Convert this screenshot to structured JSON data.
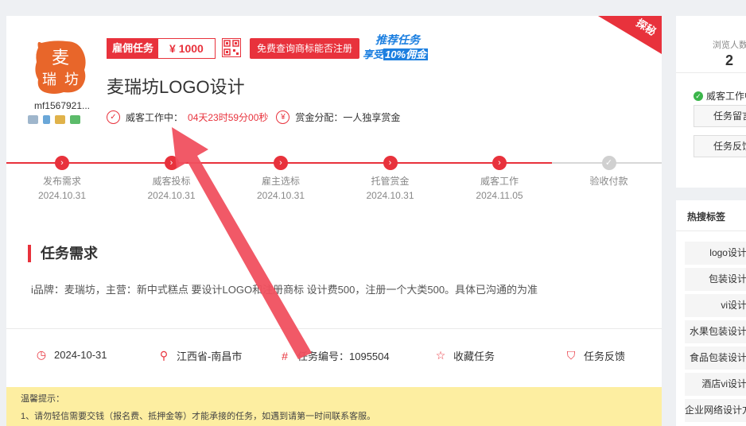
{
  "ribbon": {
    "label": "探秘"
  },
  "shop": {
    "logo_text": "麦瑞坊",
    "username": "mf1567921...",
    "icons": [
      "id-card-icon",
      "phone-icon",
      "email-icon",
      "bank-card-icon"
    ]
  },
  "header": {
    "task_type": "雇佣任务",
    "amount": "¥ 1000",
    "free_check": "免费查询商标能否注册",
    "promo_line1": "推荐任务",
    "promo_line2_prefix": "享受",
    "promo_line2_hl": "10%佣金"
  },
  "title": "麦瑞坊LOGO设计",
  "status": {
    "label": "威客工作中：",
    "countdown": "04天23时59分00秒",
    "reward_label": "赏金分配：一人独享赏金"
  },
  "steps": [
    {
      "name": "发布需求",
      "date": "2024.10.31",
      "done": true
    },
    {
      "name": "威客投标",
      "date": "2024.10.31",
      "done": true
    },
    {
      "name": "雇主选标",
      "date": "2024.10.31",
      "done": true
    },
    {
      "name": "托管赏金",
      "date": "2024.10.31",
      "done": true
    },
    {
      "name": "威客工作",
      "date": "2024.11.05",
      "done": true
    },
    {
      "name": "验收付款",
      "date": "",
      "done": false
    }
  ],
  "requirement": {
    "heading": "任务需求",
    "text": "i品牌：麦瑞坊，主营：新中式糕点 要设计LOGO和注册商标  设计费500，注册一个大类500。具体已沟通的为准"
  },
  "meta": {
    "date": "2024-10-31",
    "location": "江西省-南昌市",
    "task_no": "任务编号：1095504",
    "favorite": "收藏任务",
    "feedback": "任务反馈"
  },
  "tips": {
    "title": "温馨提示：",
    "line1": "1、请勿轻信需要交钱（报名费、抵押金等）才能承接的任务，如遇到请第一时间联系客服。"
  },
  "sidebar": {
    "views_label": "浏览人数",
    "views": "2",
    "work_status": "威客工作中",
    "btn_message": "任务留言",
    "btn_feedback": "任务反馈",
    "hot_tags_title": "热搜标签",
    "hot_tags": [
      "logo设计",
      "包装设计",
      "vi设计",
      "水果包装设计",
      "食品包装设计",
      "酒店vi设计",
      "企业网络设计方案"
    ]
  },
  "colors": {
    "accent": "#e8323c",
    "promo": "#1c7fe0",
    "tips_bg": "#fdeea1"
  }
}
